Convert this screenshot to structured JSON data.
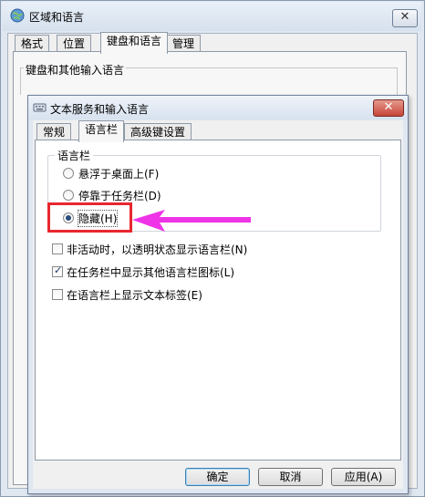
{
  "outer": {
    "title": "区域和语言",
    "close_label": "✕",
    "tabs": [
      "格式",
      "位置",
      "键盘和语言",
      "管理"
    ],
    "group_label": "键盘和其他输入语言"
  },
  "dialog": {
    "title": "文本服务和输入语言",
    "close_label": "✕",
    "tabs": [
      "常规",
      "语言栏",
      "高级键设置"
    ],
    "language_bar": {
      "group_label": "语言栏",
      "options": [
        {
          "label": "悬浮于桌面上(F)",
          "checked": false
        },
        {
          "label": "停靠于任务栏(D)",
          "checked": false
        },
        {
          "label": "隐藏(H)",
          "checked": true
        }
      ]
    },
    "checkboxes": [
      {
        "label": "非活动时，以透明状态显示语言栏(N)",
        "checked": false
      },
      {
        "label": "在任务栏中显示其他语言栏图标(L)",
        "checked": true
      },
      {
        "label": "在语言栏上显示文本标签(E)",
        "checked": false
      }
    ],
    "buttons": {
      "ok": "确定",
      "cancel": "取消",
      "apply": "应用(A)"
    }
  },
  "annotation": {
    "arrow_color": "#ee34e6",
    "box_color": "#e8272f"
  }
}
